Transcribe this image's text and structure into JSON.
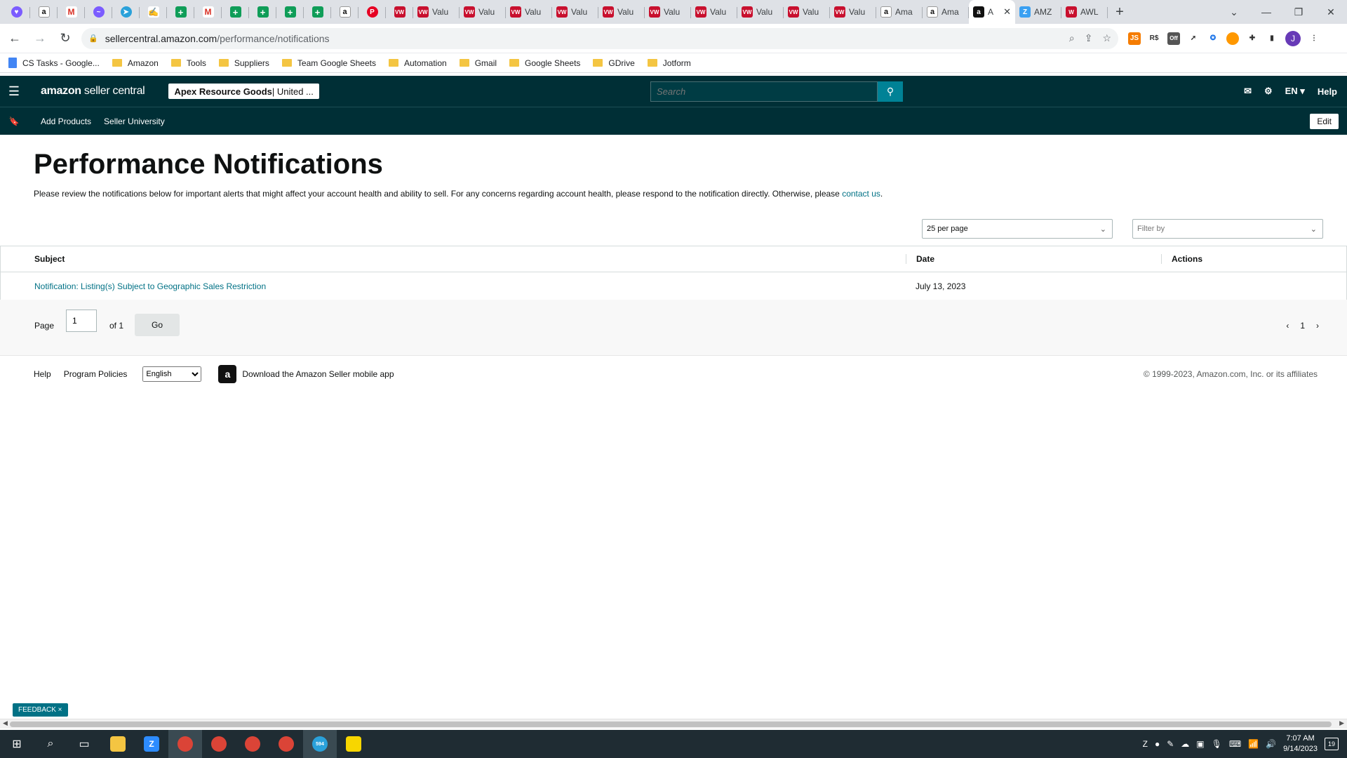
{
  "browser": {
    "tabs": [
      {
        "icon": "shield-heart-icon",
        "label": "",
        "cls": "sm"
      },
      {
        "icon": "amazon-icon",
        "label": "",
        "cls": "sm"
      },
      {
        "icon": "gmail-icon",
        "label": "",
        "cls": "sm"
      },
      {
        "icon": "messenger-icon",
        "label": "",
        "cls": "sm"
      },
      {
        "icon": "telegram-icon",
        "label": "",
        "cls": "sm"
      },
      {
        "icon": "signature-icon",
        "label": "",
        "cls": "sm"
      },
      {
        "icon": "sheets-icon",
        "label": "",
        "cls": "sm"
      },
      {
        "icon": "gmail-icon",
        "label": "",
        "cls": "sm"
      },
      {
        "icon": "sheets-icon",
        "label": "",
        "cls": "sm"
      },
      {
        "icon": "sheets-icon",
        "label": "",
        "cls": "sm"
      },
      {
        "icon": "sheets-icon",
        "label": "",
        "cls": "sm"
      },
      {
        "icon": "sheets-icon",
        "label": "",
        "cls": "sm"
      },
      {
        "icon": "amazon-icon",
        "label": "",
        "cls": "sm"
      },
      {
        "icon": "pinterest-icon",
        "label": "",
        "cls": "sm"
      },
      {
        "icon": "vw-icon",
        "label": "",
        "cls": "sm"
      },
      {
        "icon": "vw-icon",
        "label": "Valu",
        "cls": "md"
      },
      {
        "icon": "vw-icon",
        "label": "Valu",
        "cls": "md"
      },
      {
        "icon": "vw-icon",
        "label": "Valu",
        "cls": "md"
      },
      {
        "icon": "vw-icon",
        "label": "Valu",
        "cls": "md"
      },
      {
        "icon": "vw-icon",
        "label": "Valu",
        "cls": "md"
      },
      {
        "icon": "vw-icon",
        "label": "Valu",
        "cls": "md"
      },
      {
        "icon": "vw-icon",
        "label": "Valu",
        "cls": "md"
      },
      {
        "icon": "vw-icon",
        "label": "Valu",
        "cls": "md"
      },
      {
        "icon": "vw-icon",
        "label": "Valu",
        "cls": "md"
      },
      {
        "icon": "vw-icon",
        "label": "Valu",
        "cls": "md"
      },
      {
        "icon": "amazon-icon",
        "label": "Ama",
        "cls": "md"
      },
      {
        "icon": "amazon-icon",
        "label": "Ama",
        "cls": "md"
      },
      {
        "icon": "amazon-icon",
        "label": "A",
        "cls": "md active"
      },
      {
        "icon": "amz-tool-icon",
        "label": "AMZ",
        "cls": "md"
      },
      {
        "icon": "awl-icon",
        "label": "AWL",
        "cls": "md"
      }
    ],
    "url_host": "sellercentral.amazon.com",
    "url_path": "/performance/notifications",
    "bookmarks": [
      {
        "label": "CS Tasks - Google...",
        "type": "doc"
      },
      {
        "label": "Amazon",
        "type": "folder"
      },
      {
        "label": "Tools",
        "type": "folder"
      },
      {
        "label": "Suppliers",
        "type": "folder"
      },
      {
        "label": "Team Google Sheets",
        "type": "folder"
      },
      {
        "label": "Automation",
        "type": "folder"
      },
      {
        "label": "Gmail",
        "type": "folder"
      },
      {
        "label": "Google Sheets",
        "type": "folder"
      },
      {
        "label": "GDrive",
        "type": "folder"
      },
      {
        "label": "Jotform",
        "type": "folder"
      }
    ],
    "profile_initial": "J"
  },
  "header": {
    "logo_bold": "amazon",
    "logo_rest": " seller central",
    "store_name": "Apex Resource Goods",
    "store_region": " | United ...",
    "search_placeholder": "Search",
    "lang": "EN ▾",
    "help": "Help"
  },
  "subnav": {
    "links": [
      "Add Products",
      "Seller University"
    ],
    "edit": "Edit"
  },
  "main": {
    "title": "Performance Notifications",
    "description": "Please review the notifications below for important alerts that might affect your account health and ability to sell. For any concerns regarding account health, please respond to the notification directly. Otherwise, please ",
    "contact_link": "contact us",
    "description_end": ".",
    "per_page": "25 per page",
    "filter": "Filter by",
    "columns": [
      "Subject",
      "Date",
      "Actions"
    ],
    "rows": [
      {
        "subject": "Notification: Listing(s) Subject to Geographic Sales Restriction",
        "date": "July 13, 2023",
        "actions": ""
      }
    ]
  },
  "pager": {
    "page_label": "Page",
    "page_value": "1",
    "of_label": "of 1",
    "go": "Go",
    "prev": "‹",
    "current": "1",
    "next": "›"
  },
  "footer": {
    "help": "Help",
    "policies": "Program Policies",
    "language": "English",
    "app_text": "Download the Amazon Seller mobile app",
    "copyright": "© 1999-2023, Amazon.com, Inc. or its affiliates"
  },
  "feedback": "FEEDBACK ×",
  "taskbar": {
    "time": "7:07 AM",
    "date": "9/14/2023",
    "notifications": "19",
    "telegram_badge": "594"
  },
  "colors": {
    "header_bg": "#002f36",
    "link": "#007185",
    "search_btn": "#008296"
  }
}
